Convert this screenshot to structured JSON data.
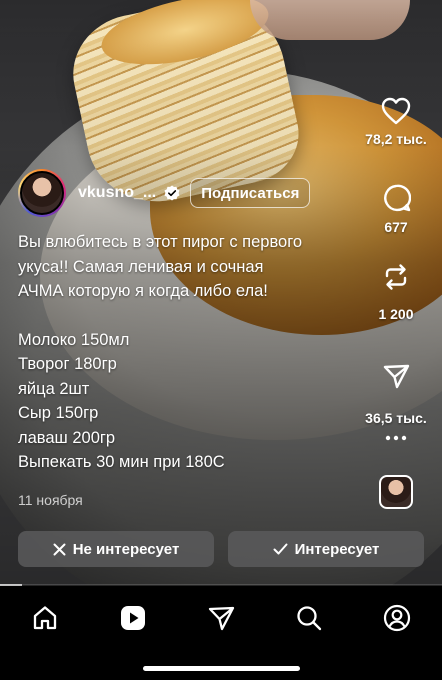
{
  "rail": {
    "likes": "78,2 тыс.",
    "comments": "677",
    "reposts": "1 200",
    "shares": "36,5 тыс."
  },
  "author": {
    "username": "vkusno_...",
    "follow_label": "Подписаться"
  },
  "caption": {
    "lines": [
      "Вы влюбитесь в этот пирог с первого",
      "укуса!! Самая ленивая и сочная",
      "АЧМА которую я когда либо ела!"
    ],
    "ingredients": [
      "Молоко 150мл",
      "Творог 180гр",
      "яйца 2шт",
      "Сыр 150гр",
      "лаваш 200гр",
      "Выпекать 30 мин при 180С"
    ]
  },
  "date": "11 ноября",
  "feedback": {
    "not_interested": "Не интересует",
    "interested": "Интересует"
  },
  "icons": {
    "like": "heart-icon",
    "comment": "comment-icon",
    "repost": "repost-icon",
    "share": "send-icon",
    "more": "more-icon",
    "nav": [
      "home-icon",
      "reels-icon",
      "send-icon",
      "search-icon",
      "profile-icon"
    ]
  },
  "colors": {
    "background": "#000000",
    "pill": "#5a5a5c",
    "text": "#ffffff"
  }
}
